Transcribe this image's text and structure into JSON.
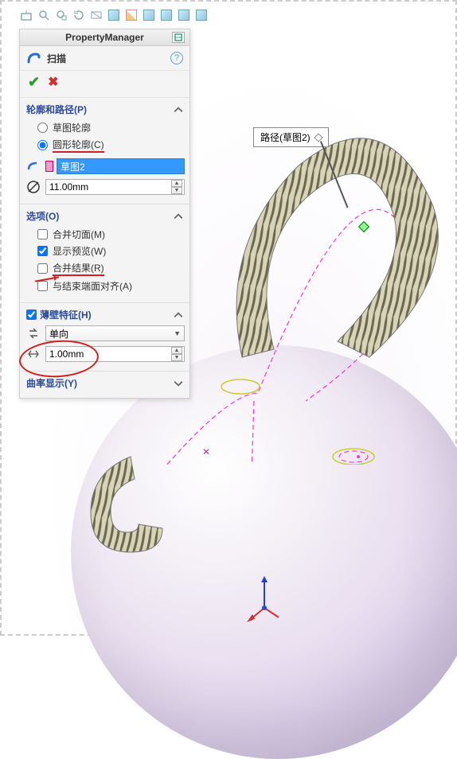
{
  "panel_title": "PropertyManager",
  "feature_name": "扫描",
  "sections": {
    "profile_path": {
      "title": "轮廓和路径(P)",
      "radio_sketch": "草图轮廓",
      "radio_circle": "圆形轮廓(C)",
      "selection": "草图2",
      "diameter": "11.00mm"
    },
    "options": {
      "title": "选项(O)",
      "merge_tangent": "合并切面(M)",
      "show_preview": "显示预览(W)",
      "merge_result": "合并结果(R)",
      "align_end": "与结束端面对齐(A)"
    },
    "thin": {
      "title": "薄壁特征(H)",
      "direction": "单向",
      "thickness": "1.00mm"
    },
    "curvature": {
      "title": "曲率显示(Y)"
    }
  },
  "callout_label": "路径(草图2)"
}
